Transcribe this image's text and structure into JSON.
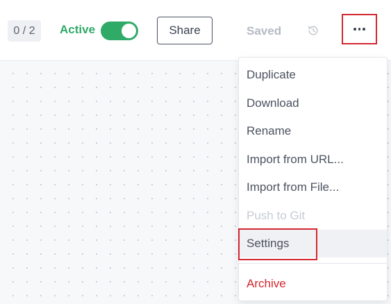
{
  "toolbar": {
    "counter": "0 / 2",
    "active_label": "Active",
    "active_toggle_on": true,
    "share_label": "Share",
    "saved_label": "Saved",
    "history_icon": "history-icon",
    "more_icon": "more-horizontal-icon"
  },
  "menu": {
    "items": [
      {
        "label": "Duplicate",
        "state": "normal"
      },
      {
        "label": "Download",
        "state": "normal"
      },
      {
        "label": "Rename",
        "state": "normal"
      },
      {
        "label": "Import from URL...",
        "state": "normal"
      },
      {
        "label": "Import from File...",
        "state": "normal"
      },
      {
        "label": "Push to Git",
        "state": "disabled"
      },
      {
        "label": "Settings",
        "state": "hover"
      },
      {
        "label": "Archive",
        "state": "danger"
      }
    ]
  },
  "colors": {
    "accent_green": "#2faa67",
    "danger_red": "#d3262f",
    "highlight_outline": "#d3262f"
  }
}
